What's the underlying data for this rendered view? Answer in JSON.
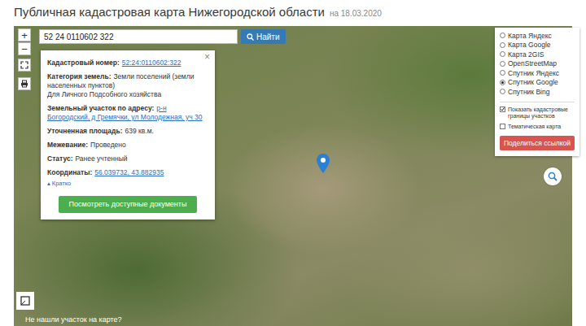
{
  "header": {
    "title": "Публичная кадастровая карта Нижегородской области",
    "date": "на 18.03.2020"
  },
  "zoom": {
    "in": "+",
    "out": "−"
  },
  "search": {
    "value": "52 24 0110602 322",
    "button": "Найти"
  },
  "popup": {
    "close": "×",
    "fields": [
      {
        "label": "Кадастровый номер:",
        "value": "52:24:0110602:322",
        "kind": "link"
      },
      {
        "label": "Категория земель:",
        "value": "Земли поселений (земли населенных пунктов)",
        "note": "Для Личного Подсобного хозяйства",
        "kind": "text"
      },
      {
        "label": "Земельный участок по адресу:",
        "value": "р-н Богородский, д Гремячки, ул Молодежная, уч 30",
        "kind": "link"
      },
      {
        "label": "Уточненная площадь:",
        "value": "639 кв.м.",
        "kind": "text"
      },
      {
        "label": "Межевание:",
        "value": "Проведено",
        "kind": "text"
      },
      {
        "label": "Статус:",
        "value": "Ранее учтенный",
        "kind": "text"
      },
      {
        "label": "Координаты:",
        "value": "56.039732, 43.882935",
        "kind": "link"
      }
    ],
    "toggle": {
      "icon": "▴",
      "label": "Кратко"
    },
    "button": "Посмотреть доступные документы"
  },
  "layers": {
    "items": [
      {
        "label": "Карта Яндекс",
        "selected": false
      },
      {
        "label": "Карта Google",
        "selected": false
      },
      {
        "label": "Карта 2GIS",
        "selected": false
      },
      {
        "label": "OpenStreetMap",
        "selected": false
      },
      {
        "label": "Спутник Яндекс",
        "selected": false
      },
      {
        "label": "Спутник Google",
        "selected": true
      },
      {
        "label": "Спутник Bing",
        "selected": false
      }
    ],
    "checks": [
      {
        "label": "Показать кадастровые границы участков",
        "checked": true
      },
      {
        "label": "Тематическая карта",
        "checked": false
      }
    ],
    "share": "Поделиться ссылкой"
  },
  "footer": "Не нашли участок на карте?"
}
